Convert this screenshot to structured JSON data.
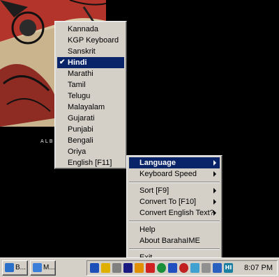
{
  "wallpaper": {
    "caption": "ALBE"
  },
  "language_menu": {
    "items": [
      {
        "label": "Kannada",
        "checked": false
      },
      {
        "label": "KGP Keyboard",
        "checked": false
      },
      {
        "label": "Sanskrit",
        "checked": false
      },
      {
        "label": "Hindi",
        "checked": true
      },
      {
        "label": "Marathi",
        "checked": false
      },
      {
        "label": "Tamil",
        "checked": false
      },
      {
        "label": "Telugu",
        "checked": false
      },
      {
        "label": "Malayalam",
        "checked": false
      },
      {
        "label": "Gujarati",
        "checked": false
      },
      {
        "label": "Punjabi",
        "checked": false
      },
      {
        "label": "Bengali",
        "checked": false
      },
      {
        "label": "Oriya",
        "checked": false
      },
      {
        "label": "English [F11]",
        "checked": false
      }
    ],
    "check_glyph": "✔"
  },
  "tray_menu": {
    "language": "Language",
    "keyboard_speed": "Keyboard Speed",
    "sort": "Sort [F9]",
    "convert_to": "Convert To [F10]",
    "convert_english": "Convert English Text?",
    "help": "Help",
    "about": "About BarahaIME",
    "exit": "Exit"
  },
  "taskbar": {
    "task_1": "B...",
    "task_2": "M...",
    "tray_hi_label": "HI",
    "clock": "8:07 PM"
  },
  "colors": {
    "menu_bg": "#d4d0c8",
    "highlight": "#0a246a",
    "desktop": "#000000"
  }
}
